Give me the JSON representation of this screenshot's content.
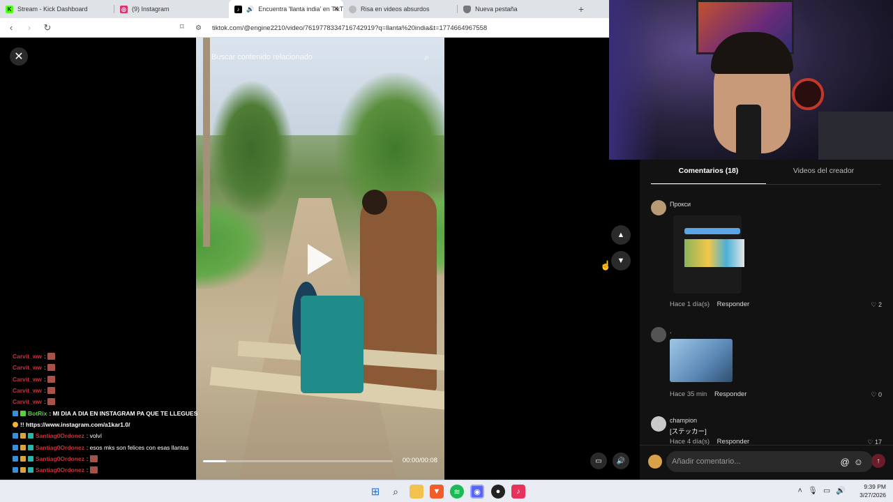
{
  "browser": {
    "tabs": [
      {
        "label": "Stream - Kick Dashboard",
        "icon": "kick-icon",
        "color": "#53fc18",
        "active": false
      },
      {
        "label": "(9) Instagram",
        "icon": "instagram-icon",
        "color": "#e1306c",
        "active": false
      },
      {
        "label": "Encuentra 'llanta india' en TikT",
        "icon": "tiktok-icon",
        "color": "#000000",
        "active": true
      },
      {
        "label": "Risa en videos absurdos",
        "icon": "globe-icon",
        "color": "#888888",
        "active": false
      },
      {
        "label": "Nueva pestaña",
        "icon": "shield-icon",
        "color": "#555555",
        "active": false
      }
    ],
    "new_tab": "+",
    "url": "tiktok.com/@engine2210/video/7619778334716742919?q=llanta%20india&t=1774664967558"
  },
  "video": {
    "search_placeholder": "Buscar contenido relacionado",
    "time": "00:00/00:08",
    "progress": 0.12
  },
  "comments_panel": {
    "tabs": [
      "Comentarios (18)",
      "Videos del creador"
    ],
    "comments": [
      {
        "user": "Прокси",
        "meta": "Hace 1 día(s)",
        "reply": "Responder",
        "likes": "2",
        "text": ""
      },
      {
        "user": ".",
        "meta": "Hace 35 min",
        "reply": "Responder",
        "likes": "0",
        "text": ""
      },
      {
        "user": "champion",
        "meta": "Hace 4 día(s)",
        "reply": "Responder",
        "likes": "17",
        "text": "[ステッカー]"
      }
    ],
    "add_placeholder": "Añadir comentario..."
  },
  "chat": [
    {
      "user": "Carvit_ww",
      "msg": ":",
      "color": "red",
      "emote": true
    },
    {
      "user": "Carvit_ww",
      "msg": ":",
      "color": "red",
      "emote": true
    },
    {
      "user": "Carvit_ww",
      "msg": ":",
      "color": "red",
      "emote": true
    },
    {
      "user": "Carvit_ww",
      "msg": ":",
      "color": "red",
      "emote": true
    },
    {
      "user": "Carvit_ww",
      "msg": ":",
      "color": "red",
      "emote": true
    },
    {
      "user": "BotRix",
      "msg": ": MI DIA A DIA EN INSTAGRAM PA QUE TE LLEGUES",
      "color": "green",
      "emote": false
    },
    {
      "user": "",
      "msg": "!! https://www.instagram.com/a1kar1.0/",
      "color": "none",
      "emote": false
    },
    {
      "user": "Santiag0Ordonez",
      "msg": ": volví",
      "color": "red",
      "emote": false
    },
    {
      "user": "Santiag0Ordonez",
      "msg": ": esos mks son felices con esas llantas",
      "color": "red",
      "emote": false
    },
    {
      "user": "Santiag0Ordonez",
      "msg": ":",
      "color": "red",
      "emote": true
    },
    {
      "user": "Santiag0Ordonez",
      "msg": ":",
      "color": "red",
      "emote": true
    }
  ],
  "taskbar": {
    "clock_time": "9:39 PM",
    "clock_date": "3/27/2026"
  }
}
